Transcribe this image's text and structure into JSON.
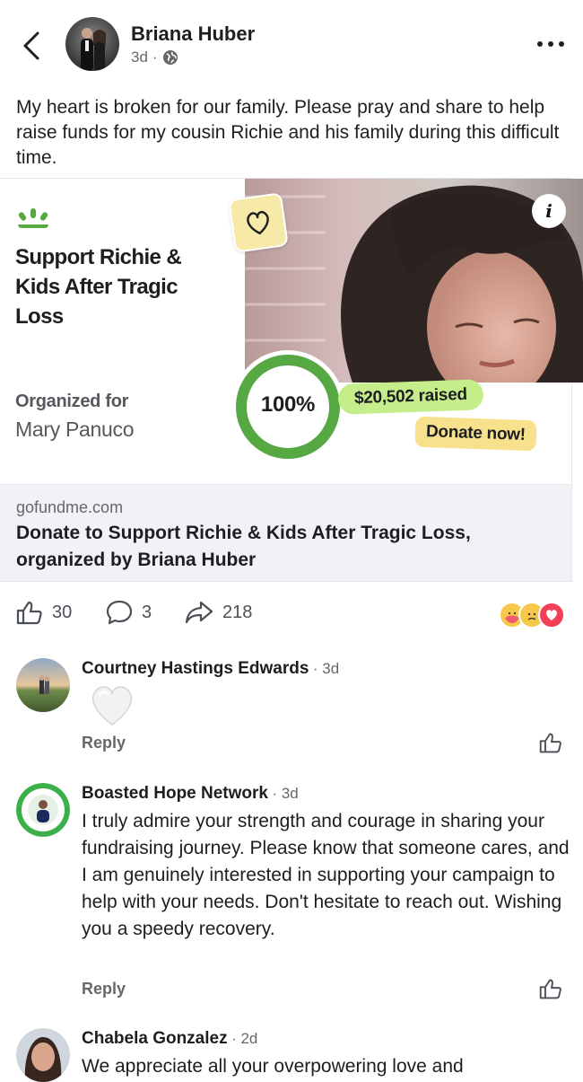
{
  "post": {
    "author": "Briana Huber",
    "time": "3d",
    "visibility_icon": "globe-icon",
    "caption": "My heart is broken for our family. Please pray and share to help raise funds for my cousin Richie and his family during this difficult time."
  },
  "fundraiser": {
    "title": "Support Richie & Kids After Tragic Loss",
    "organized_for_label": "Organized for",
    "organized_for_name": "Mary Panuco",
    "progress_percent": 100,
    "progress_label": "100%",
    "raised": "$20,502 raised",
    "donate_label": "Donate now!",
    "accent_color": "#56a843"
  },
  "link": {
    "domain": "gofundme.com",
    "title": "Donate to Support Richie & Kids After Tragic Loss, organized by Briana Huber"
  },
  "actions": {
    "likes": "30",
    "comments": "3",
    "shares": "218",
    "reaction_icons": [
      "care-reaction-icon",
      "sad-reaction-icon",
      "love-reaction-icon"
    ]
  },
  "comments": [
    {
      "author": "Courtney Hastings Edwards",
      "time": "3d",
      "text": "",
      "sticker": "white-heart-icon",
      "reply": "Reply"
    },
    {
      "author": "Boasted Hope Network",
      "time": "3d",
      "text": "I truly admire your strength and courage in sharing your fundraising journey. Please know that someone cares, and I am genuinely interested in supporting your campaign to help with your needs. Don't hesitate to reach out. Wishing you a speedy recovery.",
      "reply": "Reply"
    },
    {
      "author": "Chabela Gonzalez",
      "time": "2d",
      "text": "We appreciate all your overpowering love and"
    }
  ],
  "colors": {
    "text": "#1c1e21",
    "muted": "#65676b",
    "gofundme_green": "#56a843",
    "raised_pill": "#c5ee8b",
    "donate_pill": "#f7e18c"
  }
}
